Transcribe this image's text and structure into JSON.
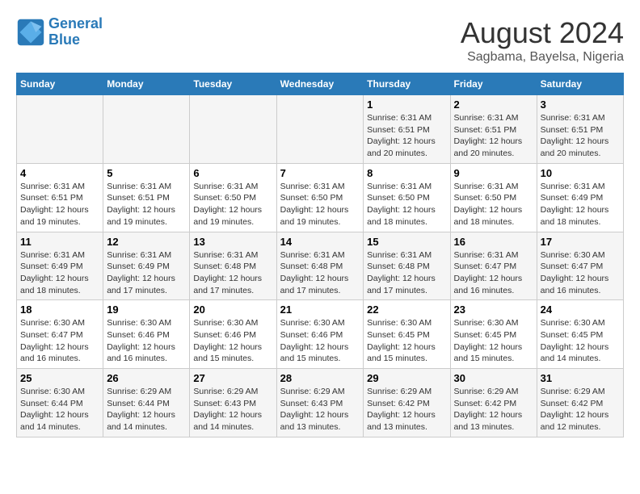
{
  "logo": {
    "line1": "General",
    "line2": "Blue"
  },
  "title": "August 2024",
  "subtitle": "Sagbama, Bayelsa, Nigeria",
  "headers": [
    "Sunday",
    "Monday",
    "Tuesday",
    "Wednesday",
    "Thursday",
    "Friday",
    "Saturday"
  ],
  "weeks": [
    [
      {
        "day": "",
        "info": ""
      },
      {
        "day": "",
        "info": ""
      },
      {
        "day": "",
        "info": ""
      },
      {
        "day": "",
        "info": ""
      },
      {
        "day": "1",
        "info": "Sunrise: 6:31 AM\nSunset: 6:51 PM\nDaylight: 12 hours and 20 minutes."
      },
      {
        "day": "2",
        "info": "Sunrise: 6:31 AM\nSunset: 6:51 PM\nDaylight: 12 hours and 20 minutes."
      },
      {
        "day": "3",
        "info": "Sunrise: 6:31 AM\nSunset: 6:51 PM\nDaylight: 12 hours and 20 minutes."
      }
    ],
    [
      {
        "day": "4",
        "info": "Sunrise: 6:31 AM\nSunset: 6:51 PM\nDaylight: 12 hours and 19 minutes."
      },
      {
        "day": "5",
        "info": "Sunrise: 6:31 AM\nSunset: 6:51 PM\nDaylight: 12 hours and 19 minutes."
      },
      {
        "day": "6",
        "info": "Sunrise: 6:31 AM\nSunset: 6:50 PM\nDaylight: 12 hours and 19 minutes."
      },
      {
        "day": "7",
        "info": "Sunrise: 6:31 AM\nSunset: 6:50 PM\nDaylight: 12 hours and 19 minutes."
      },
      {
        "day": "8",
        "info": "Sunrise: 6:31 AM\nSunset: 6:50 PM\nDaylight: 12 hours and 18 minutes."
      },
      {
        "day": "9",
        "info": "Sunrise: 6:31 AM\nSunset: 6:50 PM\nDaylight: 12 hours and 18 minutes."
      },
      {
        "day": "10",
        "info": "Sunrise: 6:31 AM\nSunset: 6:49 PM\nDaylight: 12 hours and 18 minutes."
      }
    ],
    [
      {
        "day": "11",
        "info": "Sunrise: 6:31 AM\nSunset: 6:49 PM\nDaylight: 12 hours and 18 minutes."
      },
      {
        "day": "12",
        "info": "Sunrise: 6:31 AM\nSunset: 6:49 PM\nDaylight: 12 hours and 17 minutes."
      },
      {
        "day": "13",
        "info": "Sunrise: 6:31 AM\nSunset: 6:48 PM\nDaylight: 12 hours and 17 minutes."
      },
      {
        "day": "14",
        "info": "Sunrise: 6:31 AM\nSunset: 6:48 PM\nDaylight: 12 hours and 17 minutes."
      },
      {
        "day": "15",
        "info": "Sunrise: 6:31 AM\nSunset: 6:48 PM\nDaylight: 12 hours and 17 minutes."
      },
      {
        "day": "16",
        "info": "Sunrise: 6:31 AM\nSunset: 6:47 PM\nDaylight: 12 hours and 16 minutes."
      },
      {
        "day": "17",
        "info": "Sunrise: 6:30 AM\nSunset: 6:47 PM\nDaylight: 12 hours and 16 minutes."
      }
    ],
    [
      {
        "day": "18",
        "info": "Sunrise: 6:30 AM\nSunset: 6:47 PM\nDaylight: 12 hours and 16 minutes."
      },
      {
        "day": "19",
        "info": "Sunrise: 6:30 AM\nSunset: 6:46 PM\nDaylight: 12 hours and 16 minutes."
      },
      {
        "day": "20",
        "info": "Sunrise: 6:30 AM\nSunset: 6:46 PM\nDaylight: 12 hours and 15 minutes."
      },
      {
        "day": "21",
        "info": "Sunrise: 6:30 AM\nSunset: 6:46 PM\nDaylight: 12 hours and 15 minutes."
      },
      {
        "day": "22",
        "info": "Sunrise: 6:30 AM\nSunset: 6:45 PM\nDaylight: 12 hours and 15 minutes."
      },
      {
        "day": "23",
        "info": "Sunrise: 6:30 AM\nSunset: 6:45 PM\nDaylight: 12 hours and 15 minutes."
      },
      {
        "day": "24",
        "info": "Sunrise: 6:30 AM\nSunset: 6:45 PM\nDaylight: 12 hours and 14 minutes."
      }
    ],
    [
      {
        "day": "25",
        "info": "Sunrise: 6:30 AM\nSunset: 6:44 PM\nDaylight: 12 hours and 14 minutes."
      },
      {
        "day": "26",
        "info": "Sunrise: 6:29 AM\nSunset: 6:44 PM\nDaylight: 12 hours and 14 minutes."
      },
      {
        "day": "27",
        "info": "Sunrise: 6:29 AM\nSunset: 6:43 PM\nDaylight: 12 hours and 14 minutes."
      },
      {
        "day": "28",
        "info": "Sunrise: 6:29 AM\nSunset: 6:43 PM\nDaylight: 12 hours and 13 minutes."
      },
      {
        "day": "29",
        "info": "Sunrise: 6:29 AM\nSunset: 6:42 PM\nDaylight: 12 hours and 13 minutes."
      },
      {
        "day": "30",
        "info": "Sunrise: 6:29 AM\nSunset: 6:42 PM\nDaylight: 12 hours and 13 minutes."
      },
      {
        "day": "31",
        "info": "Sunrise: 6:29 AM\nSunset: 6:42 PM\nDaylight: 12 hours and 12 minutes."
      }
    ]
  ]
}
